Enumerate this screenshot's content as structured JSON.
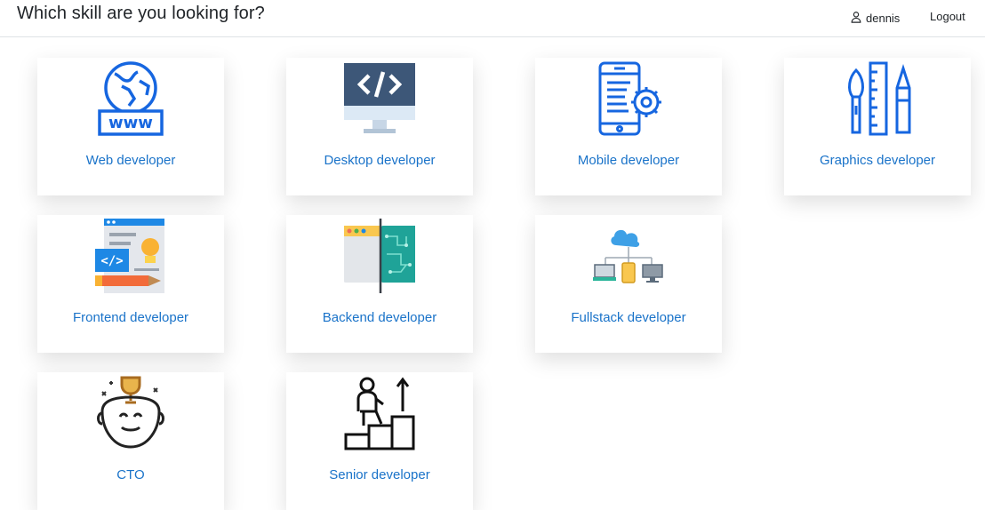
{
  "header": {
    "title": "Which skill are you looking for?",
    "user": {
      "name": "dennis",
      "icon": "user-icon"
    },
    "logout_label": "Logout"
  },
  "skills": [
    {
      "label": "Web developer",
      "icon": "web-globe-icon"
    },
    {
      "label": "Desktop developer",
      "icon": "desktop-code-icon"
    },
    {
      "label": "Mobile developer",
      "icon": "mobile-gear-icon"
    },
    {
      "label": "Graphics developer",
      "icon": "design-tools-icon"
    },
    {
      "label": "Frontend developer",
      "icon": "frontend-code-icon"
    },
    {
      "label": "Backend developer",
      "icon": "circuit-board-icon"
    },
    {
      "label": "Fullstack developer",
      "icon": "cloud-network-icon"
    },
    {
      "label": "CTO",
      "icon": "trophy-head-icon"
    },
    {
      "label": "Senior developer",
      "icon": "career-steps-icon"
    }
  ],
  "colors": {
    "accent": "#1a73c9",
    "icon_blue": "#1666e0"
  }
}
